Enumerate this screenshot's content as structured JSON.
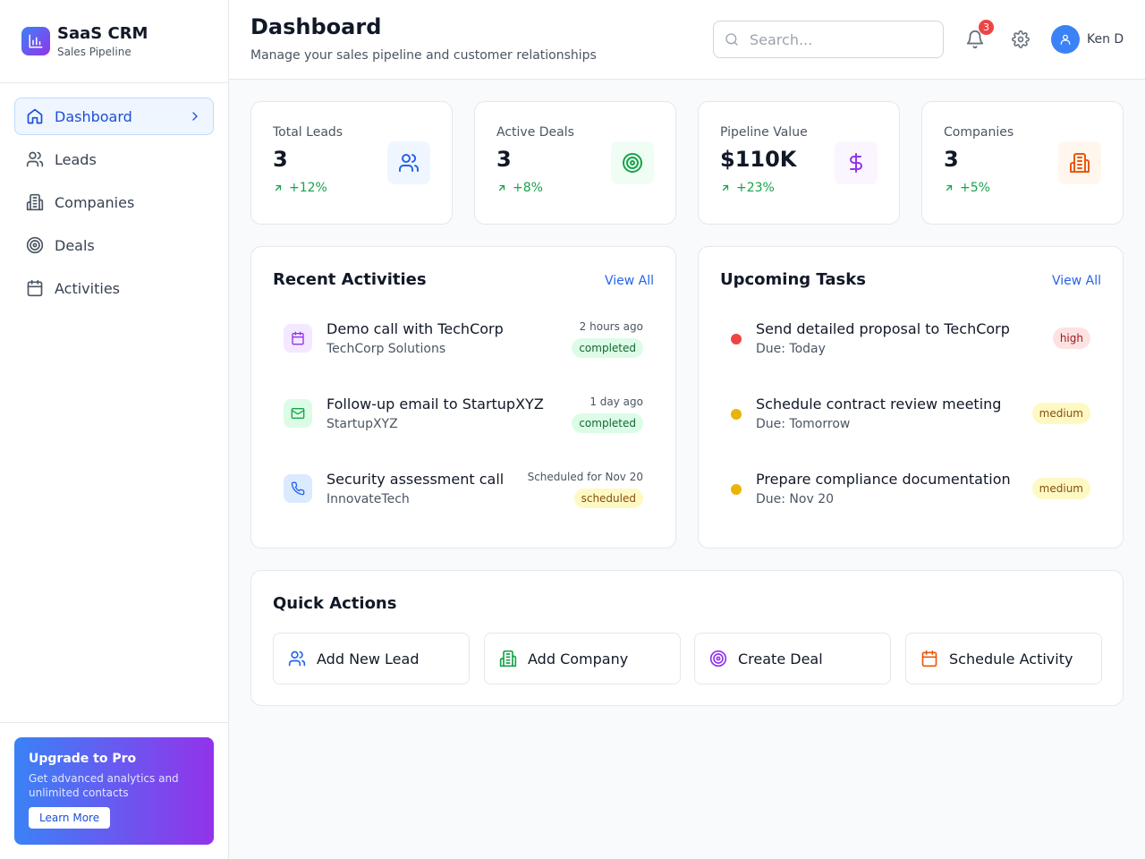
{
  "app": {
    "name": "SaaS CRM",
    "subtitle": "Sales Pipeline"
  },
  "sidebar": {
    "items": [
      {
        "label": "Dashboard",
        "icon": "home-icon",
        "active": true
      },
      {
        "label": "Leads",
        "icon": "users-icon"
      },
      {
        "label": "Companies",
        "icon": "building-icon"
      },
      {
        "label": "Deals",
        "icon": "target-icon"
      },
      {
        "label": "Activities",
        "icon": "calendar-icon"
      }
    ],
    "promo": {
      "title": "Upgrade to Pro",
      "text": "Get advanced analytics and unlimited contacts",
      "button": "Learn More"
    }
  },
  "header": {
    "title": "Dashboard",
    "subtitle": "Manage your sales pipeline and customer relationships",
    "search_placeholder": "Search...",
    "notifications": "3",
    "user": "Ken D"
  },
  "stats": [
    {
      "label": "Total Leads",
      "value": "3",
      "change": "+12%",
      "icon": "users-icon",
      "color": "#2563eb",
      "bg": "#eff6ff"
    },
    {
      "label": "Active Deals",
      "value": "3",
      "change": "+8%",
      "icon": "target-icon",
      "color": "#16a34a",
      "bg": "#f0fdf4"
    },
    {
      "label": "Pipeline Value",
      "value": "$110K",
      "change": "+23%",
      "icon": "dollar-icon",
      "color": "#9333ea",
      "bg": "#faf5ff"
    },
    {
      "label": "Companies",
      "value": "3",
      "change": "+5%",
      "icon": "building-icon",
      "color": "#ea580c",
      "bg": "#fff7ed"
    }
  ],
  "recent_activities": {
    "title": "Recent Activities",
    "view_all": "View All",
    "items": [
      {
        "title": "Demo call with TechCorp",
        "company": "TechCorp Solutions",
        "time": "2 hours ago",
        "status": "completed",
        "icon": "calendar-icon"
      },
      {
        "title": "Follow-up email to StartupXYZ",
        "company": "StartupXYZ",
        "time": "1 day ago",
        "status": "completed",
        "icon": "mail-icon"
      },
      {
        "title": "Security assessment call",
        "company": "InnovateTech",
        "time": "Scheduled for Nov 20",
        "status": "scheduled",
        "icon": "phone-icon"
      }
    ]
  },
  "upcoming_tasks": {
    "title": "Upcoming Tasks",
    "view_all": "View All",
    "items": [
      {
        "title": "Send detailed proposal to TechCorp",
        "due": "Due: Today",
        "priority": "high"
      },
      {
        "title": "Schedule contract review meeting",
        "due": "Due: Tomorrow",
        "priority": "medium"
      },
      {
        "title": "Prepare compliance documentation",
        "due": "Due: Nov 20",
        "priority": "medium"
      }
    ]
  },
  "quick_actions": {
    "title": "Quick Actions",
    "items": [
      {
        "label": "Add New Lead",
        "icon": "users-icon"
      },
      {
        "label": "Add Company",
        "icon": "building-icon"
      },
      {
        "label": "Create Deal",
        "icon": "target-icon"
      },
      {
        "label": "Schedule Activity",
        "icon": "calendar-icon"
      }
    ]
  }
}
